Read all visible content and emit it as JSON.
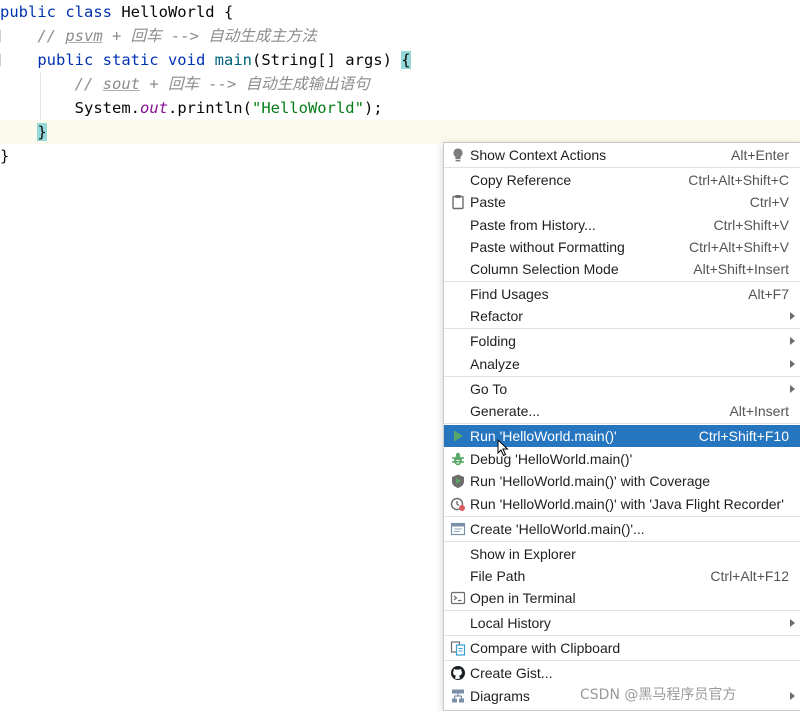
{
  "editor": {
    "line1": {
      "kw": "public class",
      "name": " HelloWorld {"
    },
    "line2": {
      "prefix": "// ",
      "tmpl": "psvm",
      "rest": " + 回车 --> 自动生成主方法"
    },
    "line3": {
      "kw": "public static void",
      "fn": "main",
      "rest": "(String[] args) ",
      "brace": "{"
    },
    "line4": {
      "prefix": "// ",
      "tmpl": "sout",
      "rest": " + 回车 --> 自动生成输出语句"
    },
    "line5": {
      "obj": "System.",
      "field": "out",
      "call": ".println(",
      "str": "\"HelloWorld\"",
      "end": ");"
    },
    "line6": {
      "brace": "}"
    },
    "line7": {
      "brace": "}"
    }
  },
  "menu": {
    "items": [
      {
        "label": "Show Context Actions",
        "shortcut": "Alt+Enter",
        "icon": "lightbulb-icon"
      },
      {
        "label": "Copy Reference",
        "shortcut": "Ctrl+Alt+Shift+C"
      },
      {
        "label": "Paste",
        "shortcut": "Ctrl+V",
        "icon": "clipboard-icon"
      },
      {
        "label": "Paste from History...",
        "shortcut": "Ctrl+Shift+V"
      },
      {
        "label": "Paste without Formatting",
        "shortcut": "Ctrl+Alt+Shift+V"
      },
      {
        "label": "Column Selection Mode",
        "shortcut": "Alt+Shift+Insert"
      },
      {
        "label": "Find Usages",
        "shortcut": "Alt+F7"
      },
      {
        "label": "Refactor",
        "submenu": true
      },
      {
        "label": "Folding",
        "submenu": true
      },
      {
        "label": "Analyze",
        "submenu": true
      },
      {
        "label": "Go To",
        "submenu": true
      },
      {
        "label": "Generate...",
        "shortcut": "Alt+Insert"
      },
      {
        "label": "Run 'HelloWorld.main()'",
        "shortcut": "Ctrl+Shift+F10",
        "icon": "run-icon",
        "selected": true
      },
      {
        "label": "Debug 'HelloWorld.main()'",
        "icon": "debug-icon"
      },
      {
        "label": "Run 'HelloWorld.main()' with Coverage",
        "icon": "coverage-icon"
      },
      {
        "label": "Run 'HelloWorld.main()' with 'Java Flight Recorder'",
        "icon": "profiler-icon"
      },
      {
        "label": "Create 'HelloWorld.main()'...",
        "icon": "run-config-icon"
      },
      {
        "label": "Show in Explorer"
      },
      {
        "label": "File Path",
        "shortcut": "Ctrl+Alt+F12"
      },
      {
        "label": "Open in Terminal",
        "icon": "terminal-icon"
      },
      {
        "label": "Local History",
        "submenu": true
      },
      {
        "label": "Compare with Clipboard",
        "icon": "compare-icon"
      },
      {
        "label": "Create Gist...",
        "icon": "github-icon"
      },
      {
        "label": "Diagrams",
        "submenu": true,
        "icon": "diagram-icon"
      }
    ]
  },
  "watermark": "CSDN @黑马程序员官方",
  "colors": {
    "selection": "#2675bf",
    "keyword": "#0033b3",
    "string": "#067d17",
    "comment": "#8c8c8c",
    "run": "#4aa84a"
  }
}
